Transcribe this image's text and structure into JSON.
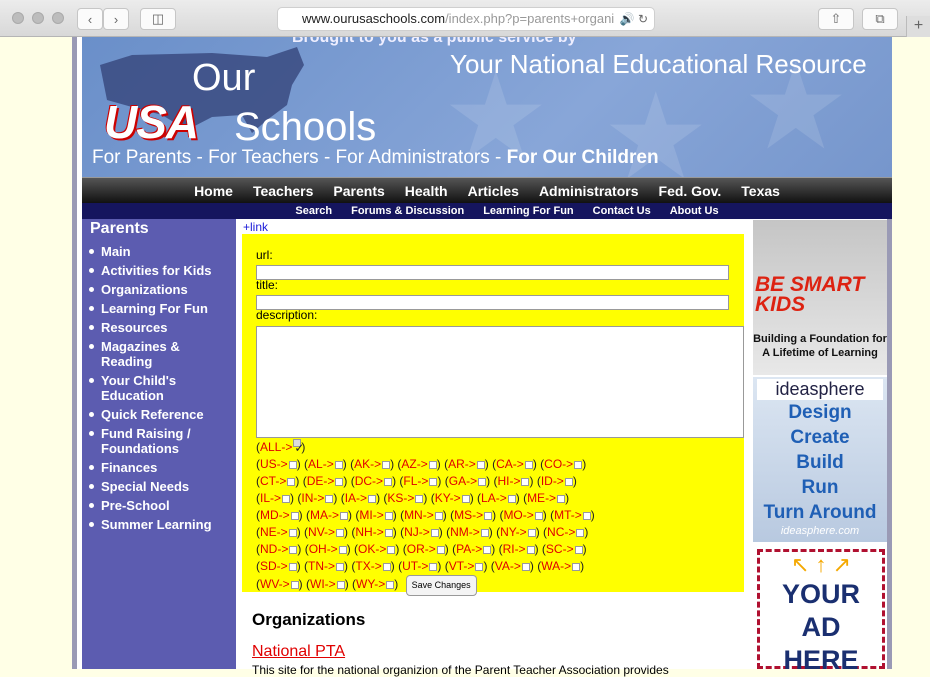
{
  "browser": {
    "url_main": "www.ourusaschools.com",
    "url_tail": "/index.php?p=parents+organi"
  },
  "banner": {
    "cutline_prefix": "Brought to you as a public service by",
    "logo_our": "Our",
    "logo_usa": "USA",
    "logo_schools": "Schools",
    "tagline": "Your National Educational Resource",
    "subline_plain": "For Parents - For Teachers - For Administrators -",
    "subline_bold": "For Our Children"
  },
  "nav_primary": [
    "Home",
    "Teachers",
    "Parents",
    "Health",
    "Articles",
    "Administrators",
    "Fed. Gov.",
    "Texas"
  ],
  "nav_secondary": [
    "Search",
    "Forums & Discussion",
    "Learning For Fun",
    "Contact Us",
    "About Us"
  ],
  "sidebar": {
    "title": "Parents",
    "items": [
      "Main",
      "Activities for Kids",
      "Organizations",
      "Learning For Fun",
      "Resources",
      "Magazines & Reading",
      "Your Child's Education",
      "Quick Reference",
      "Fund Raising / Foundations",
      "Finances",
      "Special Needs",
      "Pre-School",
      "Summer Learning"
    ]
  },
  "form": {
    "add_link": "+link",
    "url_label": "url:",
    "title_label": "title:",
    "description_label": "description:",
    "all_label": "ALL->",
    "states": [
      [
        "US->",
        "AL->",
        "AK->",
        "AZ->",
        "AR->",
        "CA->",
        "CO->"
      ],
      [
        "CT->",
        "DE->",
        "DC->",
        "FL->",
        "GA->",
        "HI->",
        "ID->"
      ],
      [
        "IL->",
        "IN->",
        "IA->",
        "KS->",
        "KY->",
        "LA->",
        "ME->"
      ],
      [
        "MD->",
        "MA->",
        "MI->",
        "MN->",
        "MS->",
        "MO->",
        "MT->"
      ],
      [
        "NE->",
        "NV->",
        "NH->",
        "NJ->",
        "NM->",
        "NY->",
        "NC->"
      ],
      [
        "ND->",
        "OH->",
        "OK->",
        "OR->",
        "PA->",
        "RI->",
        "SC->"
      ],
      [
        "SD->",
        "TN->",
        "TX->",
        "UT->",
        "VT->",
        "VA->",
        "WA->"
      ],
      [
        "WV->",
        "WI->",
        "WY->"
      ]
    ],
    "save_label": "Save Changes"
  },
  "content": {
    "heading": "Organizations",
    "first_link": "National PTA",
    "first_desc": "This site for the national organizion of the Parent Teacher Association provides"
  },
  "ads": {
    "kids_brand": "BE SMART KIDS",
    "kids_caption": "Building a Foundation for A Lifetime of Learning",
    "idea_brand": "ideasphere",
    "idea_words": [
      "Design",
      "Create",
      "Build",
      "Run",
      "Turn Around"
    ],
    "idea_domain": "ideasphere.com",
    "your_ad": [
      "YOUR",
      "AD",
      "HERE"
    ]
  },
  "colors": {
    "sidebar": "#5c5cb0",
    "form_bg": "#ffff00",
    "state_red": "#e00000"
  }
}
